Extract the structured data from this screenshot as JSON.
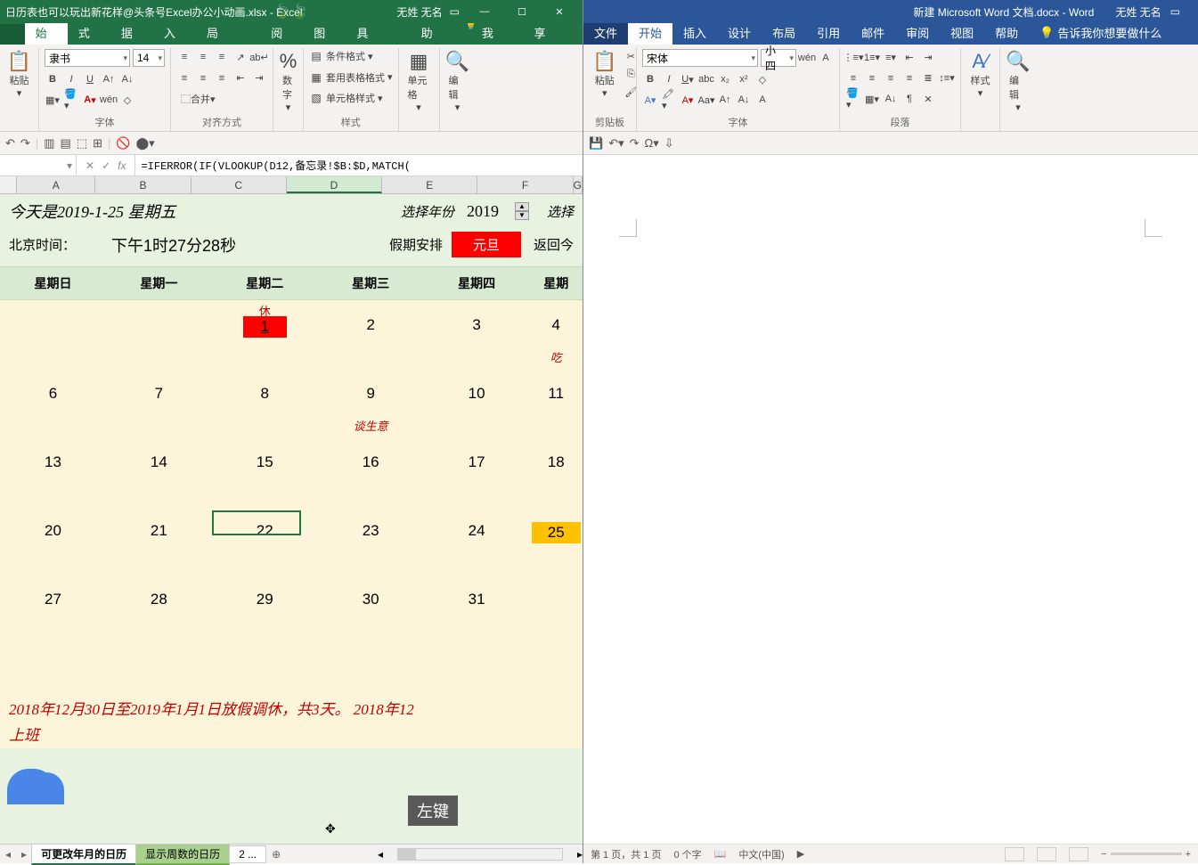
{
  "excel": {
    "title_file": "日历表也可以玩出新花样@头条号Excel办公小动画.xlsx  -  Excel",
    "title_user": "无姓 无名",
    "tabs": [
      "开始",
      "公式",
      "数据",
      "插入",
      "页面布局",
      "审阅",
      "视图",
      "开发工具",
      "帮助"
    ],
    "tell_me": "告诉我",
    "share": "共享",
    "font_name": "隶书",
    "font_size": "14",
    "group_clipboard": "粘贴",
    "group_font": "字体",
    "group_align": "对齐方式",
    "group_number_btn": "数字",
    "group_styles": "样式",
    "style_cond": "条件格式",
    "style_table": "套用表格格式",
    "style_cell": "单元格样式",
    "group_cells": "单元格",
    "group_edit": "编辑",
    "formula": "=IFERROR(IF(VLOOKUP(D12,备忘录!$B:$D,MATCH(",
    "col_headers": [
      "A",
      "B",
      "C",
      "D",
      "E",
      "F",
      "G"
    ],
    "today_label": "今天是2019-1-25 星期五",
    "year_label": "选择年份",
    "year_value": "2019",
    "month_label": "选择",
    "bj_time_label": "北京时间：",
    "bj_time_value": "下午1时27分28秒",
    "holiday_label": "假期安排",
    "holiday_value": "元旦",
    "return_label": "返回今",
    "weekdays": [
      "星期日",
      "星期一",
      "星期二",
      "星期三",
      "星期四",
      "星期"
    ],
    "cal": {
      "r1": [
        {
          "n": ""
        },
        {
          "n": ""
        },
        {
          "n": "1",
          "top": "休",
          "red": true
        },
        {
          "n": "2"
        },
        {
          "n": "3"
        },
        {
          "n": "4",
          "bot": "吃"
        }
      ],
      "r2": [
        {
          "n": "6"
        },
        {
          "n": "7"
        },
        {
          "n": "8"
        },
        {
          "n": "9",
          "bot": "谈生意"
        },
        {
          "n": "10"
        },
        {
          "n": "11"
        }
      ],
      "r3": [
        {
          "n": "13"
        },
        {
          "n": "14"
        },
        {
          "n": "15"
        },
        {
          "n": "16"
        },
        {
          "n": "17"
        },
        {
          "n": "18"
        }
      ],
      "r4": [
        {
          "n": "20"
        },
        {
          "n": "21"
        },
        {
          "n": "22"
        },
        {
          "n": "23"
        },
        {
          "n": "24"
        },
        {
          "n": "25",
          "orange": true
        }
      ],
      "r5": [
        {
          "n": "27"
        },
        {
          "n": "28"
        },
        {
          "n": "29"
        },
        {
          "n": "30"
        },
        {
          "n": "31"
        },
        {
          "n": ""
        }
      ]
    },
    "footer_note": "2018年12月30日至2019年1月1日放假调休，共3天。 2018年12",
    "footer_note2": "上班",
    "sheet_tab1": "可更改年月的日历",
    "sheet_tab2": "显示周数的日历",
    "sheet_tab3": "2 ...",
    "tooltip": "左键"
  },
  "word": {
    "title_file": "新建 Microsoft Word 文档.docx - Word",
    "title_user": "无姓 无名",
    "tabs": [
      "文件",
      "开始",
      "插入",
      "设计",
      "布局",
      "引用",
      "邮件",
      "审阅",
      "视图",
      "帮助"
    ],
    "tell_me": "告诉我你想要做什么",
    "font_name": "宋体",
    "font_size": "小四",
    "group_clipboard": "剪贴板",
    "group_paste": "粘贴",
    "group_font": "字体",
    "group_para": "段落",
    "group_style": "样式",
    "group_edit": "编辑",
    "status_page": "第 1 页，共 1 页",
    "status_words": "0 个字",
    "status_lang": "中文(中国)"
  }
}
